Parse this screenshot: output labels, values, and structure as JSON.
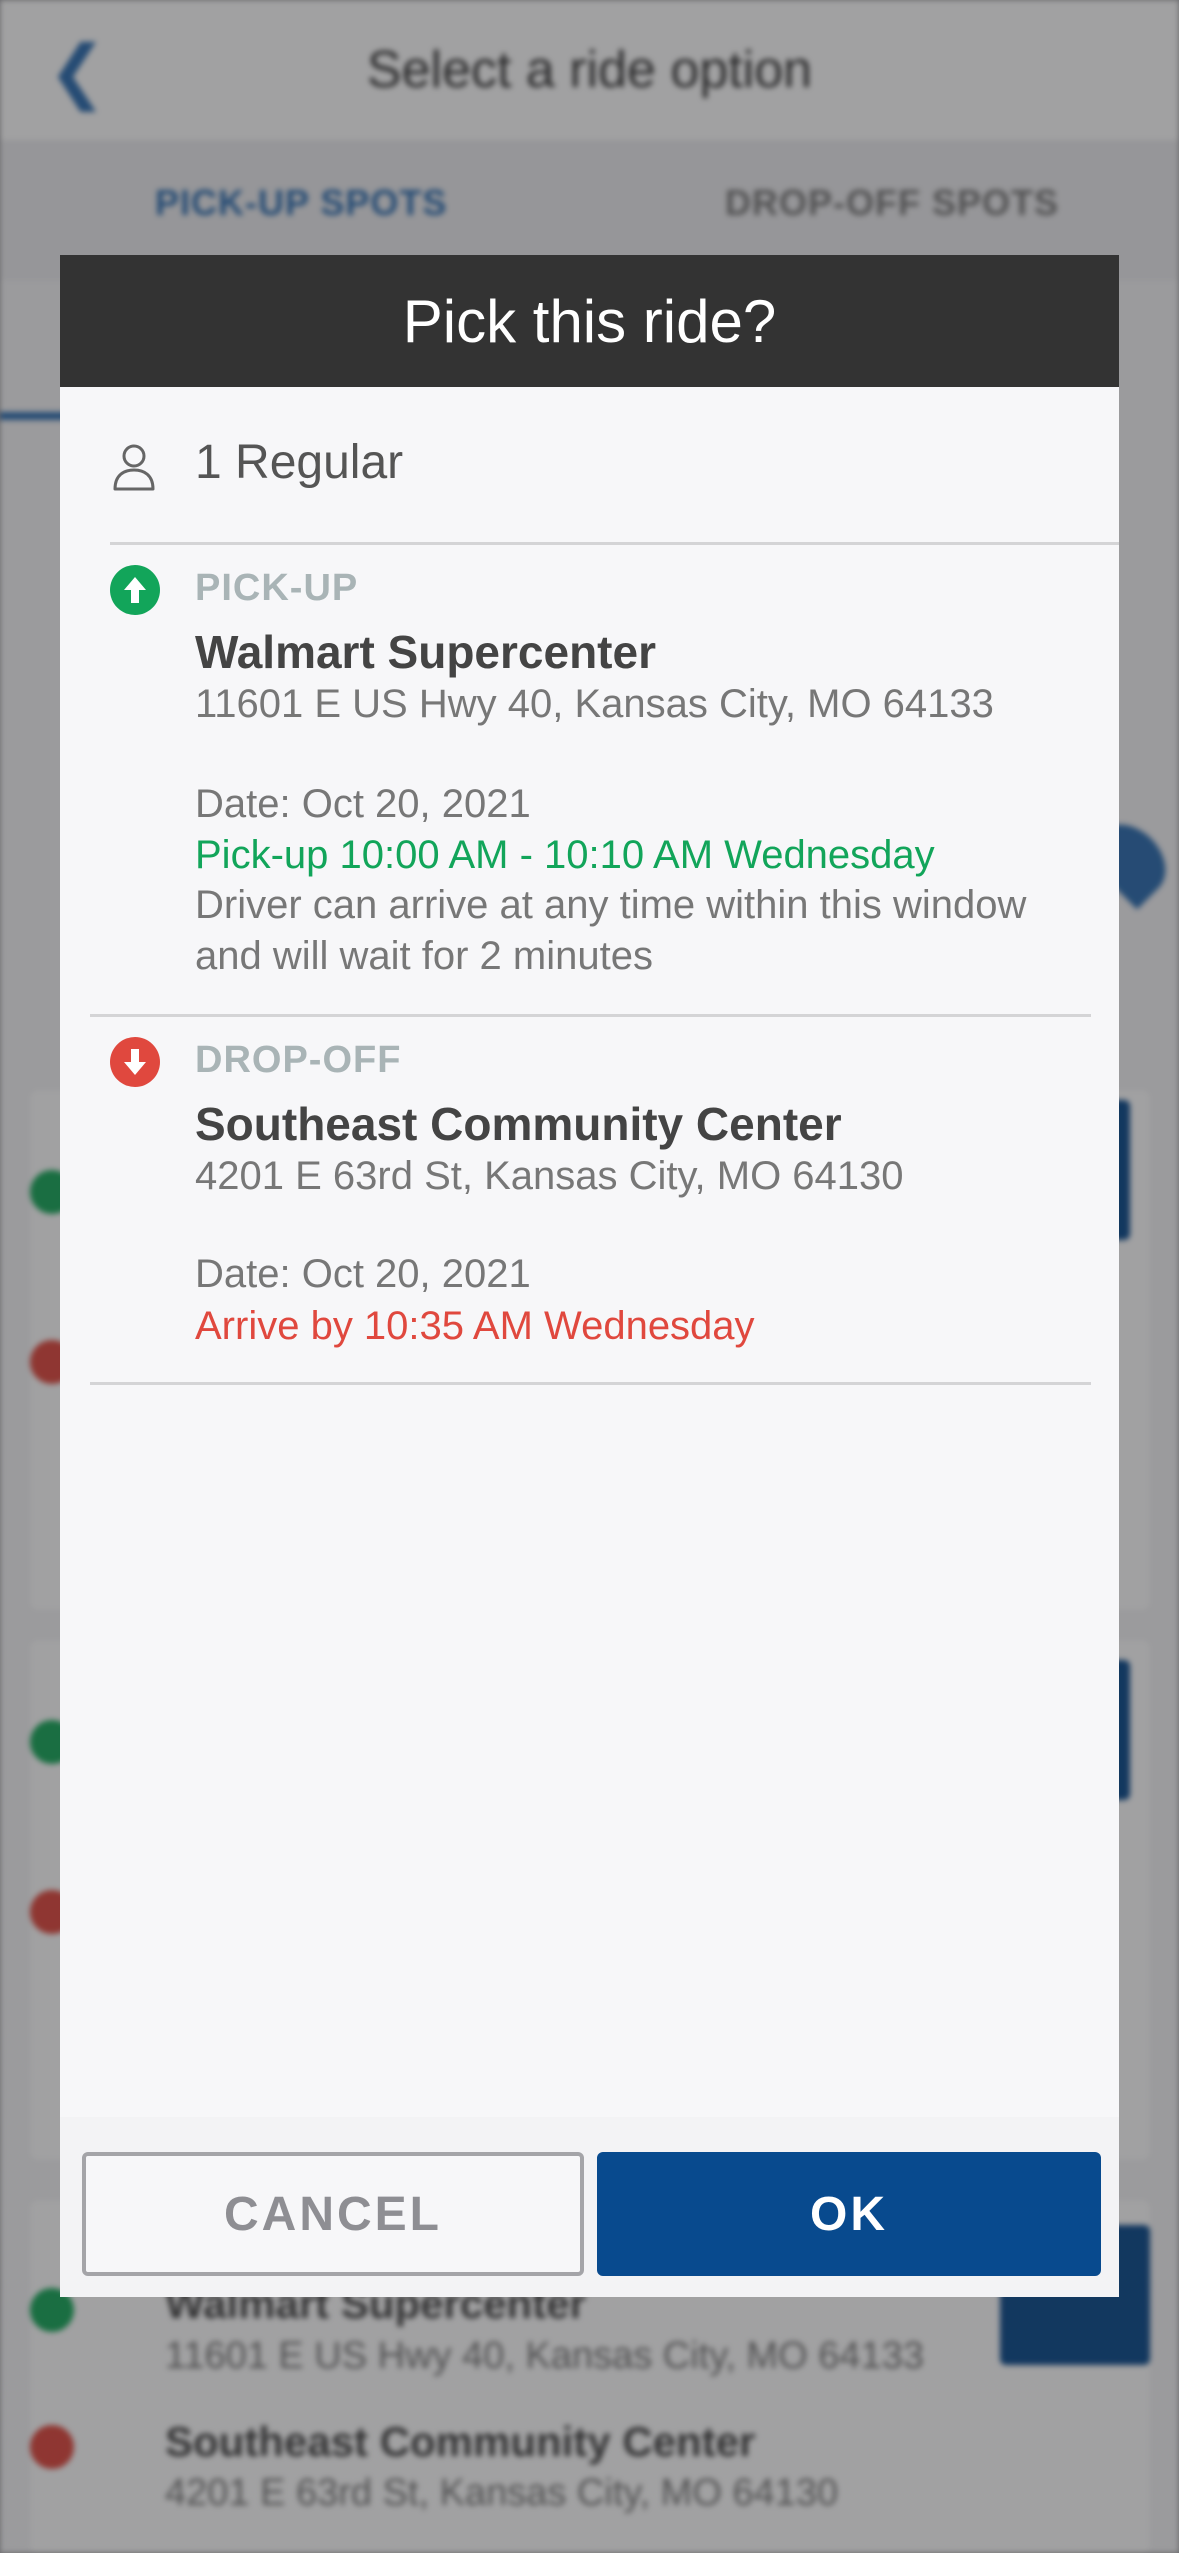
{
  "background": {
    "title": "Select a ride option",
    "tabs": [
      {
        "label": "PICK-UP SPOTS"
      },
      {
        "label": "DROP-OFF SPOTS"
      }
    ],
    "stops": [
      {
        "name": "Walmart Supercenter",
        "address": "11601 E US Hwy 40, Kansas City, MO 64133"
      },
      {
        "name": "Southeast Community Center",
        "address": "4201 E 63rd St, Kansas City, MO 64130"
      }
    ]
  },
  "dialog": {
    "title": "Pick this ride?",
    "passengers": "1 Regular",
    "pickup": {
      "label": "PICK-UP",
      "name": "Walmart Supercenter",
      "address": "11601 E US Hwy 40, Kansas City, MO 64133",
      "date": "Date: Oct 20, 2021",
      "window": "Pick-up 10:00 AM - 10:10 AM Wednesday",
      "note": "Driver can arrive at any time within this window and will wait for 2 minutes"
    },
    "dropoff": {
      "label": "DROP-OFF",
      "name": "Southeast Community Center",
      "address": "4201 E 63rd St, Kansas City, MO 64130",
      "date": "Date: Oct 20, 2021",
      "window": "Arrive by 10:35 AM Wednesday"
    },
    "buttons": {
      "cancel": "CANCEL",
      "ok": "OK"
    }
  },
  "colors": {
    "header": "#333333",
    "pickup_green": "#12a55a",
    "dropoff_red": "#e0483e",
    "primary_blue": "#084a8e"
  },
  "icons": {
    "passenger": "person-icon",
    "pickup": "arrow-up-circle-icon",
    "dropoff": "arrow-down-circle-icon",
    "back": "chevron-left-icon"
  }
}
